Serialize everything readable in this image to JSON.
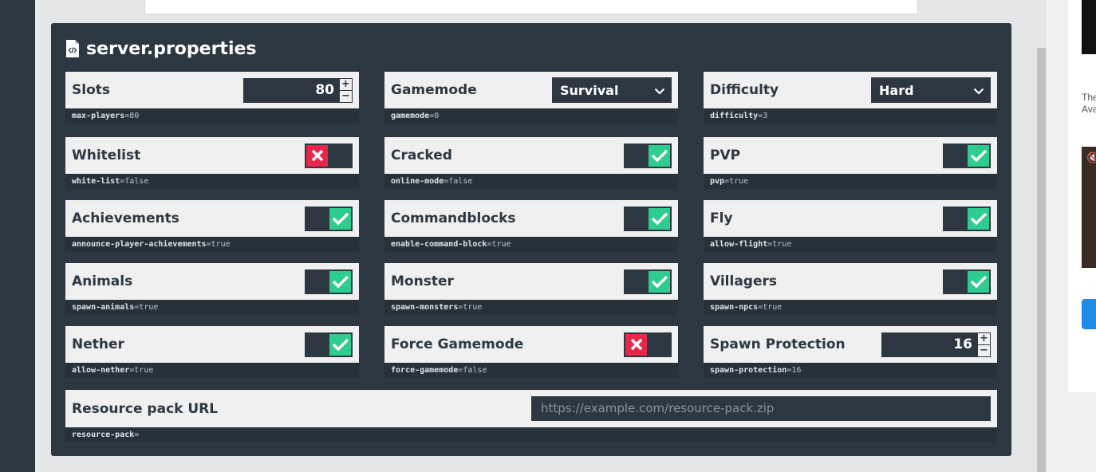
{
  "panel": {
    "title": "server.properties"
  },
  "cards": [
    {
      "label": "Slots",
      "control": "number",
      "value": "80",
      "key": "max-players",
      "kv": "=80"
    },
    {
      "label": "Gamemode",
      "control": "select",
      "value": "Survival",
      "key": "gamemode",
      "kv": "=0"
    },
    {
      "label": "Difficulty",
      "control": "select",
      "value": "Hard",
      "key": "difficulty",
      "kv": "=3"
    },
    {
      "label": "Whitelist",
      "control": "toggle",
      "on": false,
      "key": "white-list",
      "kv": "=false"
    },
    {
      "label": "Cracked",
      "control": "toggle",
      "on": true,
      "key": "online-mode",
      "kv": "=false"
    },
    {
      "label": "PVP",
      "control": "toggle",
      "on": true,
      "key": "pvp",
      "kv": "=true"
    },
    {
      "label": "Achievements",
      "control": "toggle",
      "on": true,
      "key": "announce-player-achievements",
      "kv": "=true"
    },
    {
      "label": "Commandblocks",
      "control": "toggle",
      "on": true,
      "key": "enable-command-block",
      "kv": "=true"
    },
    {
      "label": "Fly",
      "control": "toggle",
      "on": true,
      "key": "allow-flight",
      "kv": "=true"
    },
    {
      "label": "Animals",
      "control": "toggle",
      "on": true,
      "key": "spawn-animals",
      "kv": "=true"
    },
    {
      "label": "Monster",
      "control": "toggle",
      "on": true,
      "key": "spawn-monsters",
      "kv": "=true"
    },
    {
      "label": "Villagers",
      "control": "toggle",
      "on": true,
      "key": "spawn-npcs",
      "kv": "=true"
    },
    {
      "label": "Nether",
      "control": "toggle",
      "on": true,
      "key": "allow-nether",
      "kv": "=true"
    },
    {
      "label": "Force Gamemode",
      "control": "toggle",
      "on": false,
      "key": "force-gamemode",
      "kv": "=false"
    },
    {
      "label": "Spawn Protection",
      "control": "number",
      "value": "16",
      "key": "spawn-protection",
      "kv": "=16"
    }
  ],
  "resource": {
    "label": "Resource pack URL",
    "placeholder": "https://example.com/resource-pack.zip",
    "key": "resource-pack",
    "kv": "="
  },
  "stepper": {
    "plus": "+",
    "minus": "−"
  },
  "ad": {
    "text_line1": "The",
    "text_line2": "Ava"
  },
  "colors": {
    "on": "#2ecc8f",
    "off": "#e8274b",
    "panel": "#2d3741",
    "card": "#f0f0f0"
  },
  "icons": {
    "file": "file-code-icon",
    "on": "check-icon",
    "off": "x-icon",
    "select": "chevron-down-icon",
    "mute": "mute-icon"
  }
}
